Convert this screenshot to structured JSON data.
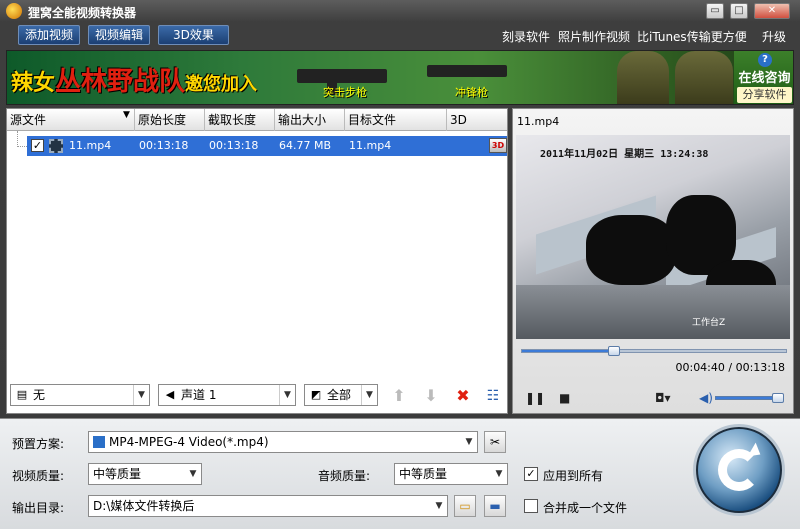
{
  "window": {
    "title": "狸窝全能视频转换器",
    "min": "▭",
    "max": "□",
    "close": "✕"
  },
  "toolbar": {
    "buttons": [
      "添加视频",
      "视频编辑",
      "3D效果"
    ],
    "links": [
      "刻录软件",
      "照片制作视频",
      "比iTunes传输更方便",
      "升级"
    ]
  },
  "banner": {
    "slogan_pre": "辣女",
    "slogan_red": "丛林野战队",
    "slogan_post": "邀您加入",
    "gun1_label": "突击步枪",
    "gun2_label": "冲锋枪",
    "consult_title": "在线咨询",
    "share_label": "分享软件",
    "help_icon": "?"
  },
  "filelist": {
    "columns": [
      "源文件",
      "原始长度",
      "截取长度",
      "输出大小",
      "目标文件",
      "3D"
    ],
    "rows": [
      {
        "name": "11.mp4",
        "original_length": "00:13:18",
        "cut_length": "00:13:18",
        "output_size": "64.77 MB",
        "target": "11.mp4",
        "checked": "✓",
        "badge": "3D"
      }
    ]
  },
  "filters": {
    "subtitle": "无",
    "audio_track": "声道 1",
    "scope": "全部"
  },
  "preview": {
    "title": "11.mp4",
    "overlay_time": "2011年11月02日 星期三 13:24:38",
    "overlay_label": "工作台Z",
    "timecode": "00:04:40 / 00:13:18",
    "progress": 0.35,
    "volume": 1.0
  },
  "settings": {
    "preset_label": "预置方案:",
    "preset_value": "MP4-MPEG-4 Video(*.mp4)",
    "video_quality_label": "视频质量:",
    "video_quality_value": "中等质量",
    "audio_quality_label": "音频质量:",
    "audio_quality_value": "中等质量",
    "apply_all_label": "应用到所有",
    "apply_all_checked": "✓",
    "output_dir_label": "输出目录:",
    "output_dir_value": "D:\\媒体文件转换后",
    "merge_label": "合并成一个文件"
  }
}
